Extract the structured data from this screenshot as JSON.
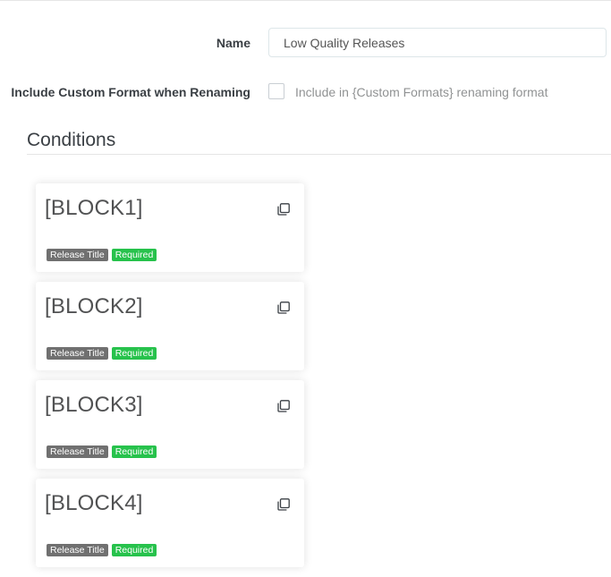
{
  "form": {
    "name_label": "Name",
    "name_value": "Low Quality Releases",
    "include_label": "Include Custom Format when Renaming",
    "include_checked": false,
    "include_help": "Include in {Custom Formats} renaming format"
  },
  "conditions": {
    "title": "Conditions",
    "cards": [
      {
        "title": "[BLOCK1]",
        "type_label": "Release Title",
        "required_label": "Required",
        "icon": "clone-icon"
      },
      {
        "title": "[BLOCK2]",
        "type_label": "Release Title",
        "required_label": "Required",
        "icon": "clone-icon"
      },
      {
        "title": "[BLOCK3]",
        "type_label": "Release Title",
        "required_label": "Required",
        "icon": "clone-icon"
      },
      {
        "title": "[BLOCK4]",
        "type_label": "Release Title",
        "required_label": "Required",
        "icon": "clone-icon"
      }
    ]
  },
  "colors": {
    "label_default": "#707070",
    "label_success": "#27c24c"
  }
}
